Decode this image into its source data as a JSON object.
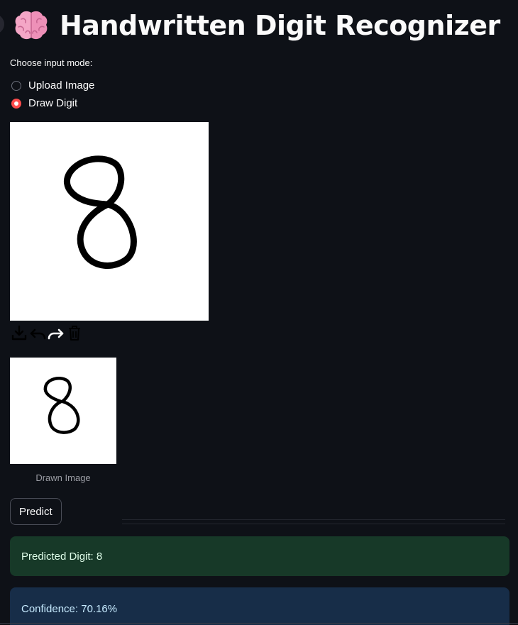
{
  "header": {
    "title": "Handwritten Digit Recognizer",
    "icon": "brain-icon"
  },
  "mode_selector": {
    "label": "Choose input mode:",
    "options": [
      "Upload Image",
      "Draw Digit"
    ],
    "selected": "Draw Digit"
  },
  "canvas": {
    "toolbar_icons": [
      "download-icon",
      "undo-icon",
      "redo-icon",
      "trash-icon"
    ]
  },
  "preview": {
    "caption": "Drawn Image"
  },
  "predict_button": {
    "label": "Predict"
  },
  "results": {
    "predicted": "Predicted Digit: 8",
    "confidence": "Confidence: 70.16%"
  },
  "colors": {
    "background": "#0e1117",
    "accent": "#ff4b4b",
    "success_bg": "#173928",
    "info_bg": "#172d48"
  }
}
